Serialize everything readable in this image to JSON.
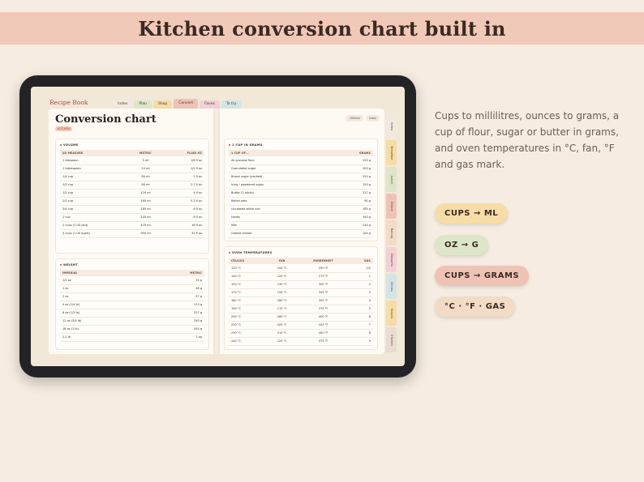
{
  "banner": {
    "title": "Kitchen conversion chart built in"
  },
  "app": {
    "book_title": "Recipe Book",
    "top_tabs": [
      {
        "label": "Index",
        "color": "#f1e9df"
      },
      {
        "label": "Plan",
        "color": "#dde6c9"
      },
      {
        "label": "Shop",
        "color": "#f6dca6"
      },
      {
        "label": "Convert",
        "color": "#efc3b4"
      },
      {
        "label": "Faves",
        "color": "#f3cfd6"
      },
      {
        "label": "To try",
        "color": "#d3e4e5"
      }
    ],
    "page_title": "Conversion chart",
    "kitchen_tag": "KITCHEN",
    "crumbs": [
      "‹ Kitchen",
      "Index"
    ],
    "side_tabs": [
      {
        "label": "Index",
        "color": "#f1e9df"
      },
      {
        "label": "Breakfast",
        "color": "#f6dca6"
      },
      {
        "label": "Lunch",
        "color": "#dde6c9"
      },
      {
        "label": "Dinner",
        "color": "#efc3b4"
      },
      {
        "label": "Baking",
        "color": "#f2dcc5"
      },
      {
        "label": "Desserts",
        "color": "#f3cfd6"
      },
      {
        "label": "Drinks",
        "color": "#d3e4e5"
      },
      {
        "label": "Snacks",
        "color": "#f6dca6"
      },
      {
        "label": "Kitchen",
        "color": "#e8ddd0"
      }
    ],
    "volume": {
      "title": "VOLUME",
      "headers": [
        "US MEASURE",
        "METRIC",
        "FLUID OZ"
      ],
      "rows": [
        [
          "1 teaspoon",
          "5 ml",
          "1/6 fl oz"
        ],
        [
          "1 tablespoon",
          "15 ml",
          "1/2 fl oz"
        ],
        [
          "1/4 cup",
          "60 ml",
          "2 fl oz"
        ],
        [
          "1/3 cup",
          "80 ml",
          "2.7 fl oz"
        ],
        [
          "1/2 cup",
          "120 ml",
          "4 fl oz"
        ],
        [
          "2/3 cup",
          "160 ml",
          "5.3 fl oz"
        ],
        [
          "3/4 cup",
          "180 ml",
          "6 fl oz"
        ],
        [
          "1 cup",
          "240 ml",
          "8 fl oz"
        ],
        [
          "2 cups (1 US pint)",
          "475 ml",
          "16 fl oz"
        ],
        [
          "4 cups (1 US quart)",
          "950 ml",
          "32 fl oz"
        ]
      ]
    },
    "weight": {
      "title": "WEIGHT",
      "headers": [
        "IMPERIAL",
        "METRIC"
      ],
      "rows": [
        [
          "1/2 oz",
          "15 g"
        ],
        [
          "1 oz",
          "28 g"
        ],
        [
          "2 oz",
          "57 g"
        ],
        [
          "4 oz (1/4 lb)",
          "113 g"
        ],
        [
          "8 oz (1/2 lb)",
          "227 g"
        ],
        [
          "12 oz (3/4 lb)",
          "340 g"
        ],
        [
          "16 oz (1 lb)",
          "454 g"
        ],
        [
          "2.2 lb",
          "1 kg"
        ]
      ]
    },
    "grams": {
      "title": "1 CUP IN GRAMS",
      "headers": [
        "1 CUP OF...",
        "GRAMS"
      ],
      "rows": [
        [
          "All-purpose flour",
          "125 g"
        ],
        [
          "Granulated sugar",
          "200 g"
        ],
        [
          "Brown sugar (packed)",
          "220 g"
        ],
        [
          "Icing / powdered sugar",
          "120 g"
        ],
        [
          "Butter (2 sticks)",
          "227 g"
        ],
        [
          "Rolled oats",
          "90 g"
        ],
        [
          "Uncooked white rice",
          "185 g"
        ],
        [
          "Honey",
          "340 g"
        ],
        [
          "Milk",
          "245 g"
        ],
        [
          "Grated cheese",
          "100 g"
        ]
      ]
    },
    "oven": {
      "title": "OVEN TEMPERATURES",
      "headers": [
        "CELSIUS",
        "FAN",
        "FAHRENHEIT",
        "GAS"
      ],
      "rows": [
        [
          "120 °C",
          "100 °C",
          "250 °F",
          "1/2"
        ],
        [
          "140 °C",
          "120 °C",
          "275 °F",
          "1"
        ],
        [
          "150 °C",
          "130 °C",
          "300 °F",
          "2"
        ],
        [
          "170 °C",
          "150 °C",
          "325 °F",
          "3"
        ],
        [
          "180 °C",
          "160 °C",
          "350 °F",
          "4"
        ],
        [
          "190 °C",
          "170 °C",
          "375 °F",
          "5"
        ],
        [
          "200 °C",
          "180 °C",
          "400 °F",
          "6"
        ],
        [
          "220 °C",
          "200 °C",
          "425 °F",
          "7"
        ],
        [
          "230 °C",
          "210 °C",
          "450 °F",
          "8"
        ],
        [
          "240 °C",
          "220 °C",
          "475 °F",
          "9"
        ]
      ]
    }
  },
  "description": "Cups to millilitres, ounces to grams, a cup of flour, sugar or butter in grams, and oven temperatures in °C, fan, °F and gas mark.",
  "chips": [
    {
      "label": "CUPS → ML",
      "color": "#f6dca6"
    },
    {
      "label": "OZ → G",
      "color": "#dde6c9"
    },
    {
      "label": "CUPS → GRAMS",
      "color": "#efc3b4"
    },
    {
      "label": "°C · °F · GAS",
      "color": "#f2dcc5"
    }
  ]
}
